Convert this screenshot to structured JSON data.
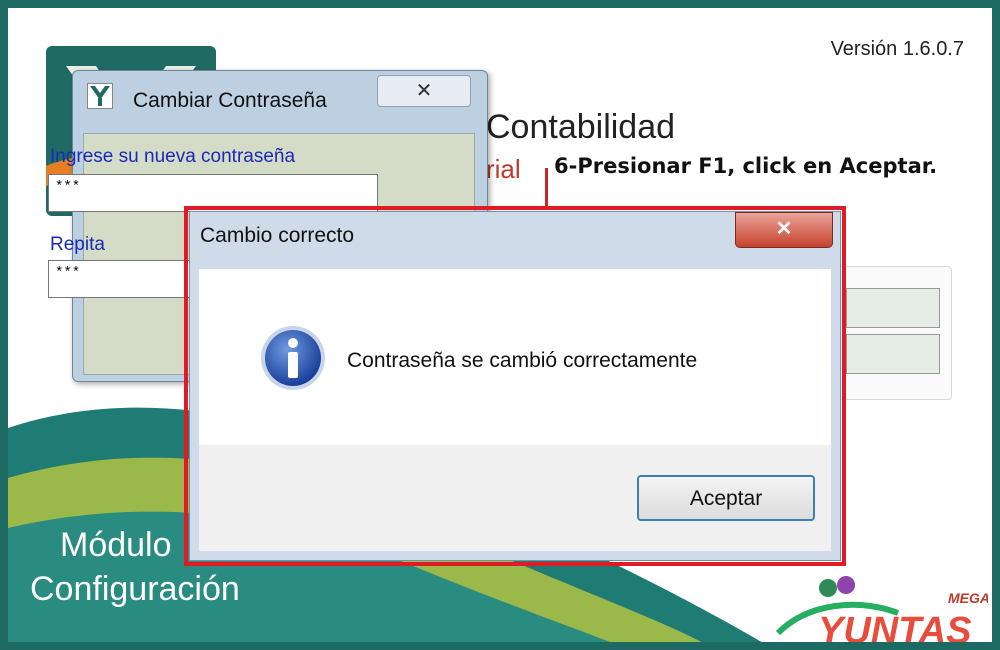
{
  "app": {
    "version": "Versión 1.6.0.7",
    "title": "Contabilidad",
    "subtitle": "rial",
    "module_line1": "Módulo",
    "module_line2": "Configuración",
    "brand_top": "MEGA",
    "brand": "YUNTAS"
  },
  "annotation": "6-Presionar F1, click en Aceptar.",
  "change_password_window": {
    "title": "Cambiar Contraseña",
    "close_glyph": "✕",
    "new_password_label": "Ingrese su nueva contraseña",
    "new_password_value": "***",
    "repeat_label": "Repita",
    "repeat_value": "***"
  },
  "dialog": {
    "title": "Cambio correcto",
    "close_glyph": "✕",
    "message": "Contraseña se cambió correctamente",
    "ok_label": "Aceptar",
    "icon": "info-icon"
  },
  "colors": {
    "frame": "#1d6a62",
    "highlight": "#e01b24",
    "label_blue": "#1a2ab5"
  }
}
